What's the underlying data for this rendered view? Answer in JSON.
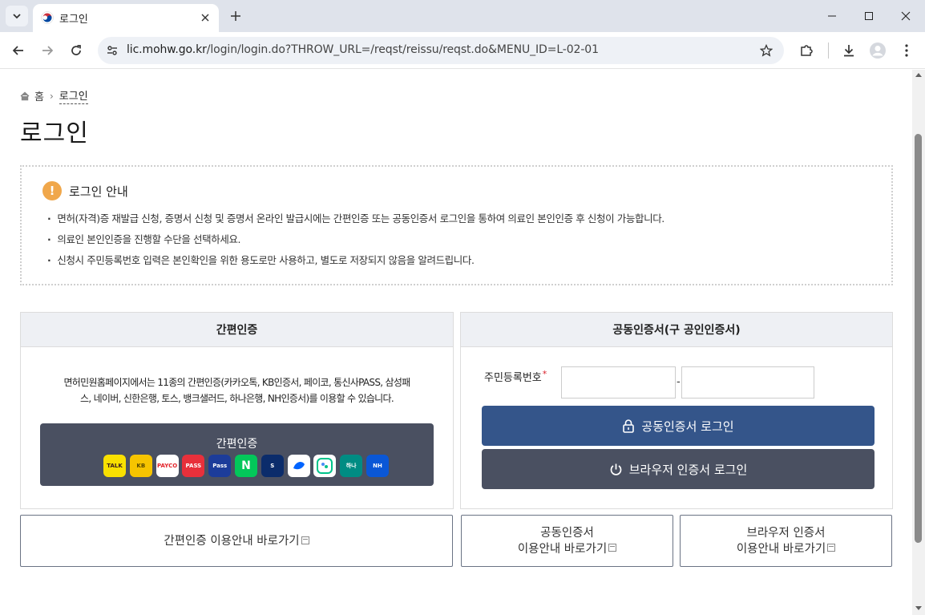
{
  "browser": {
    "tab_title": "로그인",
    "url_host": "lic.mohw.go.kr",
    "url_path": "/login/login.do?THROW_URL=/reqst/reissu/reqst.do&MENU_ID=L-02-01"
  },
  "breadcrumb": {
    "home": "홈",
    "current": "로그인"
  },
  "page": {
    "title": "로그인"
  },
  "notice": {
    "title": "로그인 안내",
    "badge": "!",
    "items": [
      "면허(자격)증 재발급 신청, 증명서 신청 및 증명서 온라인 발급시에는 간편인증 또는 공동인증서 로그인을 통하여 의료인 본인인증 후 신청이 가능합니다.",
      "의료인 본인인증을 진행할 수단을 선택하세요.",
      "신청시 주민등록번호 입력은 본인확인을 위한 용도로만 사용하고, 별도로 저장되지 않음을 알려드립니다."
    ]
  },
  "simple_auth": {
    "header": "간편인증",
    "description_line1": "면허민원홈페이지에서는 11종의 간편인증(카카오톡, KB인증서, 페이코, 통신사PASS, 삼성패",
    "description_line2": "스, 네이버, 신한은행, 토스, 뱅크샐러드, 하나은행, NH인증서)를 이용할 수 있습니다.",
    "button_label": "간편인증",
    "providers": [
      {
        "name": "kakaotalk",
        "text": "TALK",
        "bg": "#f9e000",
        "fg": "#3a1d1d"
      },
      {
        "name": "kb",
        "text": "KB",
        "bg": "#f6c400",
        "fg": "#5a4a00"
      },
      {
        "name": "payco",
        "text": "PAYCO",
        "bg": "#ffffff",
        "fg": "#e3232a"
      },
      {
        "name": "pass",
        "text": "PASS",
        "bg": "#e8303b",
        "fg": "#ffffff"
      },
      {
        "name": "samsung-pass",
        "text": "Pass",
        "bg": "#1c3c9a",
        "fg": "#ffffff"
      },
      {
        "name": "naver",
        "text": "N",
        "bg": "#03c75a",
        "fg": "#ffffff"
      },
      {
        "name": "shinhan",
        "text": "S",
        "bg": "#0b2c6b",
        "fg": "#ffffff"
      },
      {
        "name": "toss",
        "text": "",
        "bg": "#ffffff",
        "fg": "#0064ff"
      },
      {
        "name": "banksalad",
        "text": "",
        "bg": "#ffffff",
        "fg": "#00c38b"
      },
      {
        "name": "hana",
        "text": "하나",
        "bg": "#008c83",
        "fg": "#ffffff"
      },
      {
        "name": "nh",
        "text": "NH",
        "bg": "#0a57d6",
        "fg": "#ffffff"
      }
    ]
  },
  "cert_auth": {
    "header": "공동인증서(구 공인인증서)",
    "rrn_label": "주민등록번호",
    "required_mark": "*",
    "rrn_front_value": "",
    "rrn_back_value": "",
    "dash": "-",
    "cert_login_label": "공동인증서 로그인",
    "browser_login_label": "브라우저 인증서 로그인"
  },
  "guides": {
    "simple": "간편인증 이용안내 바로가기",
    "cert_line1": "공동인증서",
    "cert_line2": "이용안내 바로가기",
    "browser_line1": "브라우저 인증서",
    "browser_line2": "이용안내 바로가기"
  }
}
